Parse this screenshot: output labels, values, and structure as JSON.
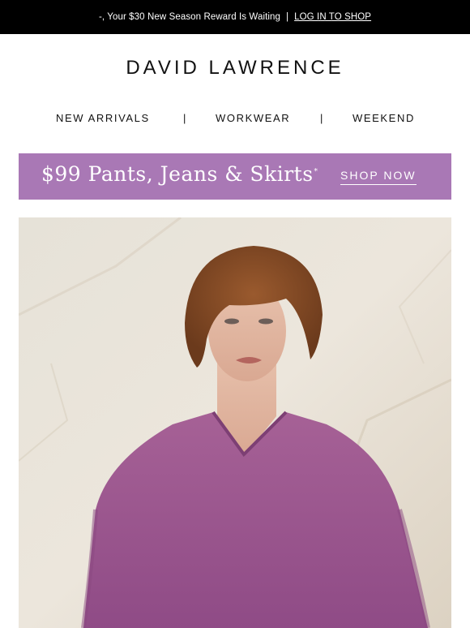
{
  "topbar": {
    "message": "-, Your $30 New Season Reward Is Waiting",
    "separator": "|",
    "login_link": "LOG IN TO SHOP"
  },
  "brand": {
    "name": "DAVID LAWRENCE"
  },
  "nav": {
    "items": [
      {
        "label": "NEW ARRIVALS"
      },
      {
        "label": "WORKWEAR"
      },
      {
        "label": "WEEKEND"
      }
    ],
    "divider": "|"
  },
  "promo": {
    "headline": "$99 Pants, Jeans & Skirts",
    "asterisk": "*",
    "cta": "SHOP NOW",
    "background": "#a978b5"
  },
  "hero": {
    "image_alt": "",
    "sweater_color": "#a05a95",
    "backdrop_color": "#e8e1d6"
  }
}
